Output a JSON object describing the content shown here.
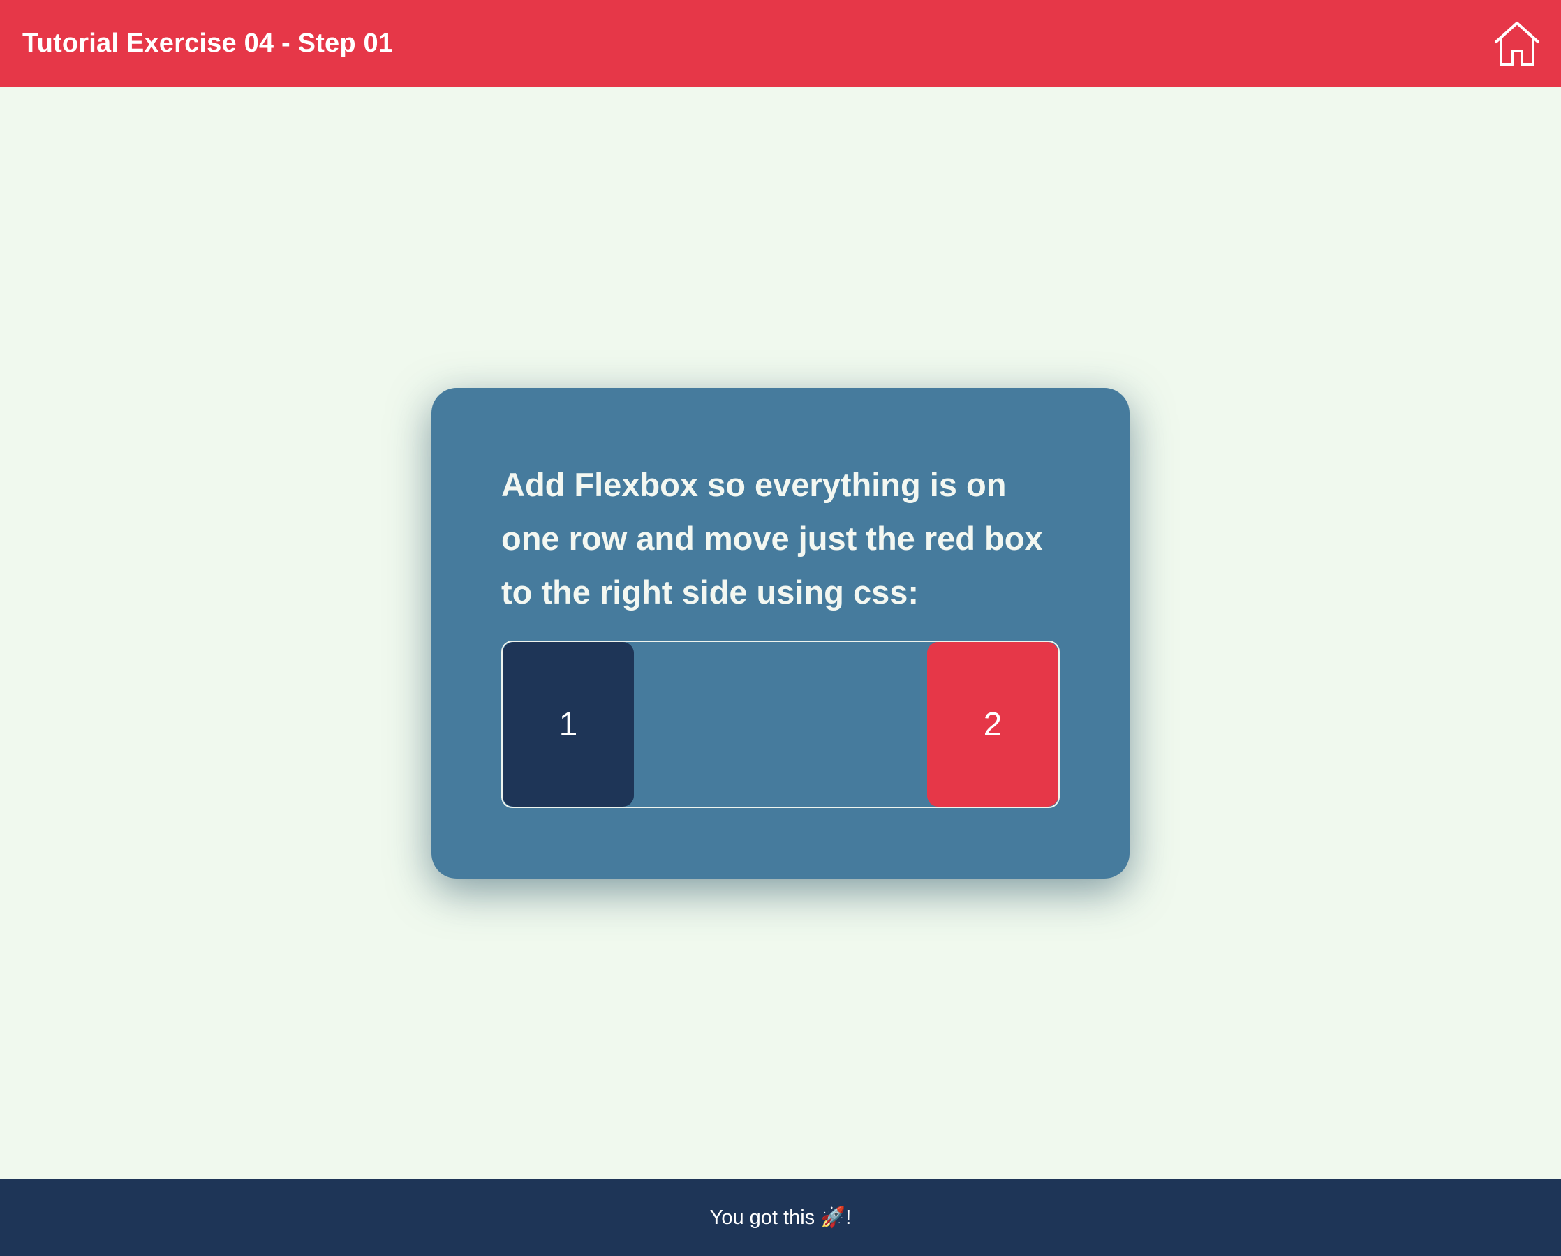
{
  "header": {
    "title": "Tutorial Exercise 04 - Step 01",
    "home_icon": "home-icon"
  },
  "card": {
    "instruction": "Add Flexbox so everything is on one row and move just the red box to the right side using css:",
    "boxes": [
      {
        "label": "1",
        "color": "#1e3557"
      },
      {
        "label": "2",
        "color": "#e63748"
      }
    ]
  },
  "footer": {
    "message": "You got this 🚀!"
  },
  "colors": {
    "header_bg": "#e63748",
    "page_bg": "#f0f9ee",
    "card_bg": "#467b9d",
    "footer_bg": "#1e3557"
  }
}
